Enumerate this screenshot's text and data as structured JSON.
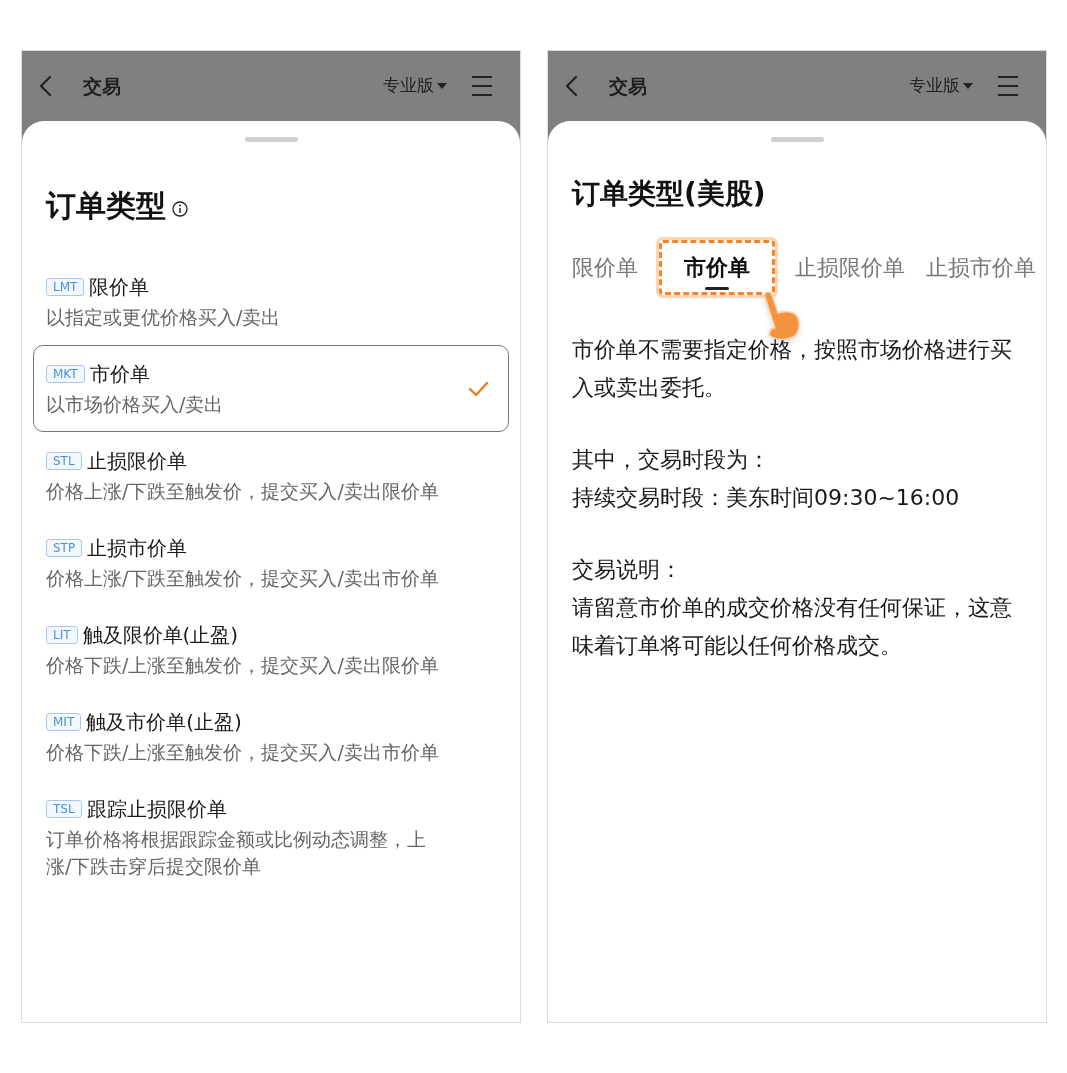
{
  "left_panel": {
    "header": {
      "title": "交易",
      "edition": "专业版"
    },
    "sheet": {
      "title": "订单类型",
      "order_types": [
        {
          "code": "LMT",
          "name": "限价单",
          "description": "以指定或更优价格买入/卖出",
          "selected": false
        },
        {
          "code": "MKT",
          "name": "市价单",
          "description": "以市场价格买入/卖出",
          "selected": true
        },
        {
          "code": "STL",
          "name": "止损限价单",
          "description": "价格上涨/下跌至触发价，提交买入/卖出限价单",
          "selected": false
        },
        {
          "code": "STP",
          "name": "止损市价单",
          "description": "价格上涨/下跌至触发价，提交买入/卖出市价单",
          "selected": false
        },
        {
          "code": "LIT",
          "name": "触及限价单(止盈)",
          "description": "价格下跌/上涨至触发价，提交买入/卖出限价单",
          "selected": false
        },
        {
          "code": "MIT",
          "name": "触及市价单(止盈)",
          "description": "价格下跌/上涨至触发价，提交买入/卖出市价单",
          "selected": false
        },
        {
          "code": "TSL",
          "name": "跟踪止损限价单",
          "description": "订单价格将根据跟踪金额或比例动态调整，上涨/下跌击穿后提交限价单",
          "selected": false
        }
      ]
    }
  },
  "right_panel": {
    "header": {
      "title": "交易",
      "edition": "专业版"
    },
    "sheet": {
      "title": "订单类型(美股)",
      "tabs": [
        {
          "label": "限价单",
          "selected": false
        },
        {
          "label": "市价单",
          "selected": true
        },
        {
          "label": "止损限价单",
          "selected": false
        },
        {
          "label": "止损市价单",
          "selected": false
        }
      ],
      "sections": [
        [
          "市价单不需要指定价格，按照市场价格进行买入或卖出委托。"
        ],
        [
          "其中，交易时段为：",
          "持续交易时段：美东时间09:30~16:00"
        ],
        [
          "交易说明：",
          "请留意市价单的成交价格没有任何保证，这意味着订单将可能以任何价格成交。"
        ]
      ]
    }
  }
}
